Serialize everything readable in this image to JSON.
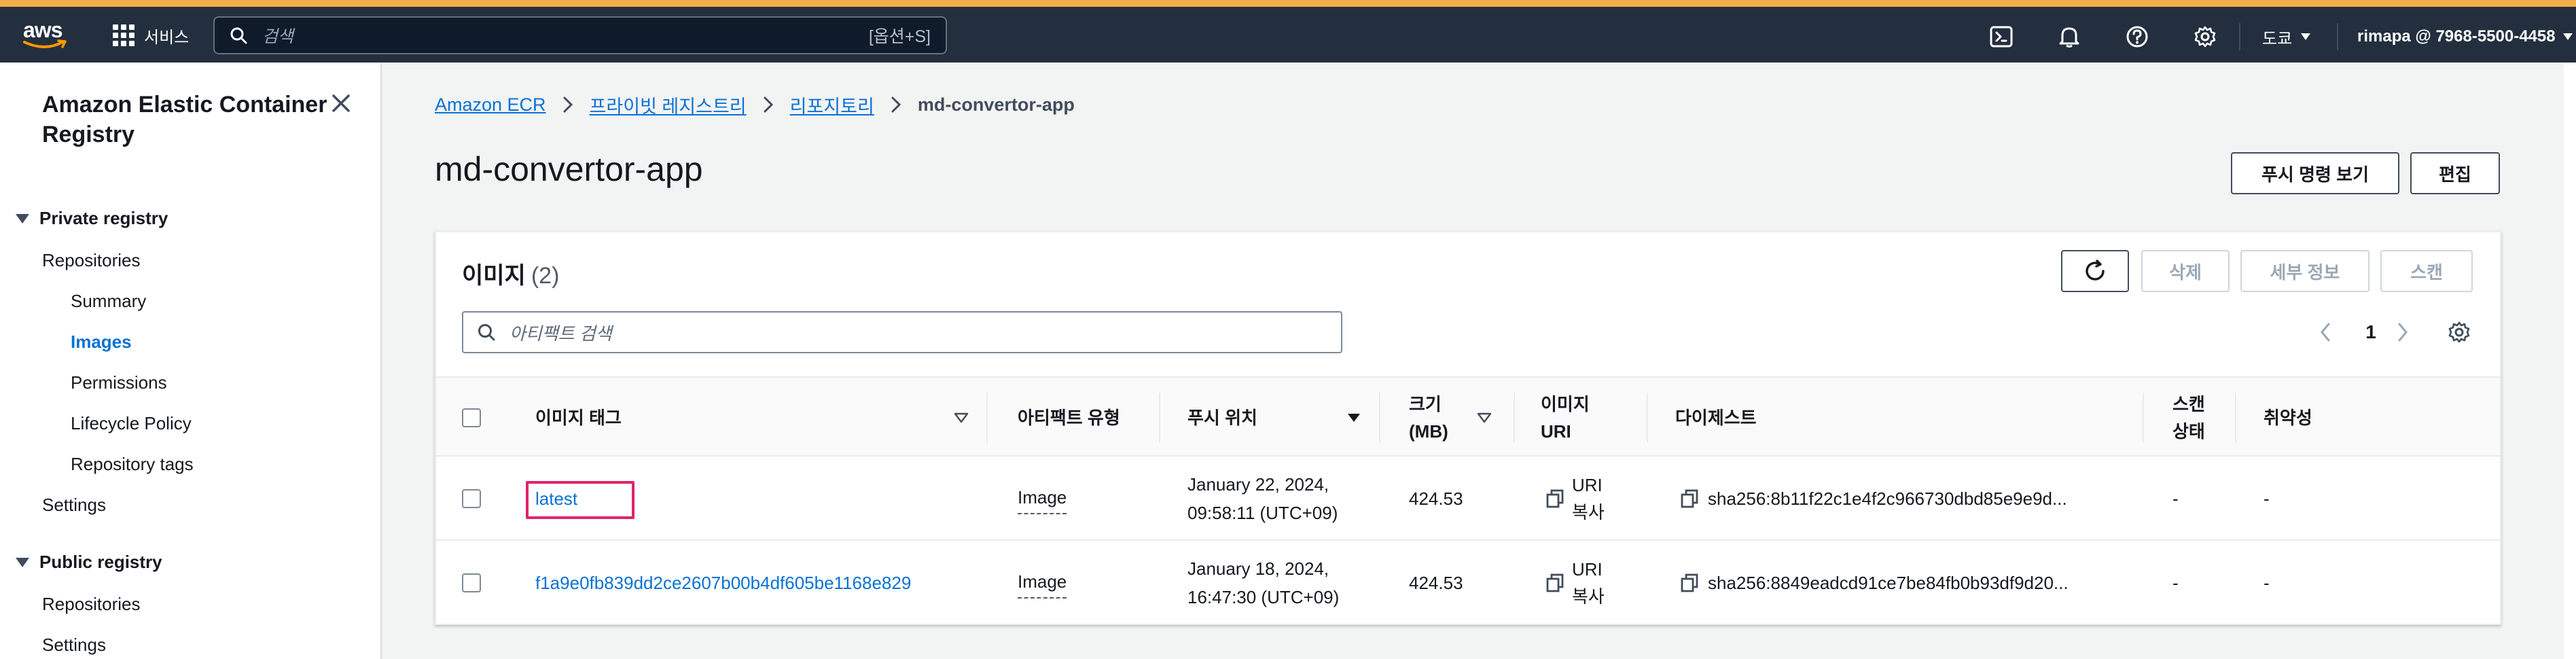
{
  "nav": {
    "logo": "aws",
    "services_label": "서비스",
    "search_placeholder": "검색",
    "search_shortcut": "[옵션+S]",
    "icons": [
      "cloudshell-icon",
      "bell-icon",
      "help-icon",
      "gear-icon"
    ],
    "region": "도쿄",
    "account": "rimapa @ 7968-5500-4458"
  },
  "sidebar": {
    "title": "Amazon Elastic Container Registry",
    "private_section": "Private registry",
    "private_items": [
      {
        "label": "Repositories",
        "level": 1,
        "active": false
      },
      {
        "label": "Summary",
        "level": 2,
        "active": false
      },
      {
        "label": "Images",
        "level": 2,
        "active": true
      },
      {
        "label": "Permissions",
        "level": 2,
        "active": false
      },
      {
        "label": "Lifecycle Policy",
        "level": 2,
        "active": false
      },
      {
        "label": "Repository tags",
        "level": 2,
        "active": false
      },
      {
        "label": "Settings",
        "level": 1,
        "active": false
      }
    ],
    "public_section": "Public registry",
    "public_items": [
      {
        "label": "Repositories",
        "level": 1
      },
      {
        "label": "Settings",
        "level": 1
      }
    ]
  },
  "breadcrumb": {
    "items": [
      "Amazon ECR",
      "프라이빗 레지스트리",
      "리포지토리"
    ],
    "current": "md-convertor-app"
  },
  "page": {
    "title": "md-convertor-app",
    "push_button": "푸시 명령 보기",
    "edit_button": "편집"
  },
  "images": {
    "title": "이미지",
    "count": "(2)",
    "delete_button": "삭제",
    "details_button": "세부 정보",
    "scan_button": "스캔",
    "search_placeholder": "아티팩트 검색",
    "page_number": "1",
    "columns": {
      "tag": "이미지 태그",
      "artifact_type": "아티팩트 유형",
      "pushed_at": "푸시 위치",
      "size_1": "크기",
      "size_2": "(MB)",
      "uri_1": "이미지",
      "uri_2": "URI",
      "digest": "다이제스트",
      "scan_1": "스캔",
      "scan_2": "상태",
      "vuln": "취약성"
    },
    "rows": [
      {
        "tag": "latest",
        "artifact_type": "Image",
        "pushed_1": "January 22, 2024,",
        "pushed_2": "09:58:11 (UTC+09)",
        "size": "424.53",
        "uri_1": "URI",
        "uri_2": "복사",
        "digest": "sha256:8b11f22c1e4f2c966730dbd85e9e9d...",
        "scan": "-",
        "vuln": "-"
      },
      {
        "tag": "f1a9e0fb839dd2ce2607b00b4df605be1168e829",
        "artifact_type": "Image",
        "pushed_1": "January 18, 2024,",
        "pushed_2": "16:47:30 (UTC+09)",
        "size": "424.53",
        "uri_1": "URI",
        "uri_2": "복사",
        "digest": "sha256:8849eadcd91ce7be84fb0b93df9d20...",
        "scan": "-",
        "vuln": "-"
      }
    ]
  },
  "colors": {
    "nav_bg": "#232f3e",
    "accent": "#f0b14a",
    "link": "#0972d3",
    "highlight": "#e0246b"
  }
}
